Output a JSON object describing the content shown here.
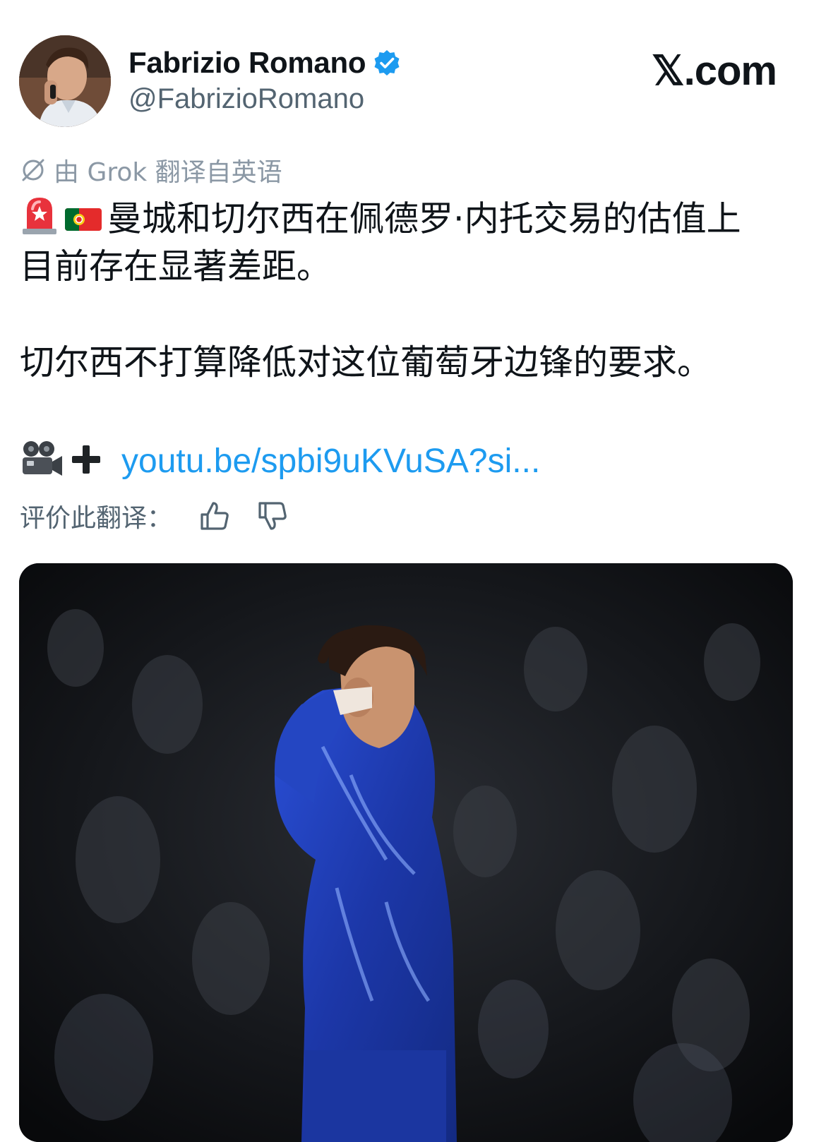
{
  "author": {
    "display_name": "Fabrizio Romano",
    "handle": "@FabrizioRomano",
    "verified": true,
    "avatar_icon": "profile-photo"
  },
  "brand": {
    "label": "𝕏.com"
  },
  "translation": {
    "note": "由 Grok 翻译自英语",
    "icon": "translate-icon",
    "rate_label": "评价此翻译："
  },
  "tweet": {
    "line1": "曼城和切尔西在佩德罗·内托交易的估值上",
    "line2": "目前存在显著差距。",
    "line3": "切尔西不打算降低对这位葡萄牙边锋的要求。",
    "emojis": [
      "🚨",
      "🇵🇹",
      "🎥",
      "➕"
    ],
    "link_text": "youtu.be/spbi9uKVuSA?si..."
  },
  "colors": {
    "link": "#1d9bf0",
    "verified": "#1d9bf0",
    "muted": "#536471",
    "text": "#0f1419",
    "jersey": "#1e3fb8"
  }
}
